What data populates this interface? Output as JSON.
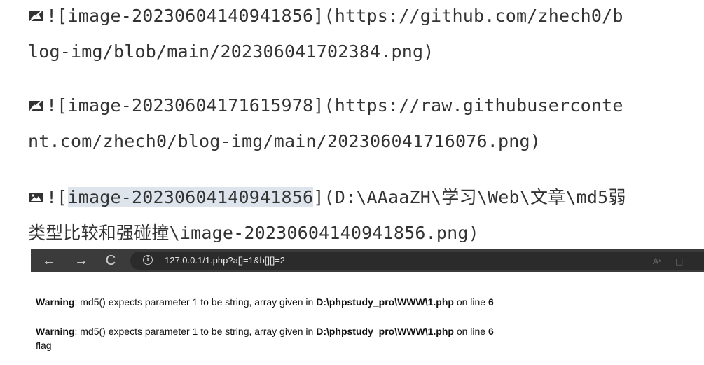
{
  "markdown": {
    "lines": [
      {
        "icon": "broken-image-icon",
        "text": "![image-20230604140941856](https://github.com/zhech0/b"
      },
      {
        "icon": "",
        "text": "log-img/blob/main/202306041702384.png)"
      },
      {
        "icon": "broken-image-icon",
        "text": "![image-20230604171615978](https://raw.githubuserconte"
      },
      {
        "icon": "",
        "text": "nt.com/zhech0/blog-img/main/202306041716076.png)"
      },
      {
        "icon": "image-icon",
        "prefix": "![",
        "selected": "image-20230604140941856",
        "suffix": "](D:\\AAaaZH\\学习\\Web\\文章\\md5弱"
      },
      {
        "icon": "",
        "text": "类型比较和强碰撞\\image-20230604140941856.png)"
      }
    ]
  },
  "browser": {
    "url": "127.0.0.1/1.php?a[]=1&b[][]=2",
    "nav": {
      "back": "←",
      "forward": "→",
      "reload": "C",
      "info": "i"
    },
    "right_icons": [
      "A⁵",
      "◫"
    ],
    "warnings": [
      {
        "label": "Warning",
        "message": ": md5() expects parameter 1 to be string, array given in ",
        "path": "D:\\phpstudy_pro\\WWW\\1.php",
        "on_line": " on line ",
        "line": "6"
      },
      {
        "label": "Warning",
        "message": ": md5() expects parameter 1 to be string, array given in ",
        "path": "D:\\phpstudy_pro\\WWW\\1.php",
        "on_line": " on line ",
        "line": "6"
      }
    ],
    "output": "flag"
  }
}
